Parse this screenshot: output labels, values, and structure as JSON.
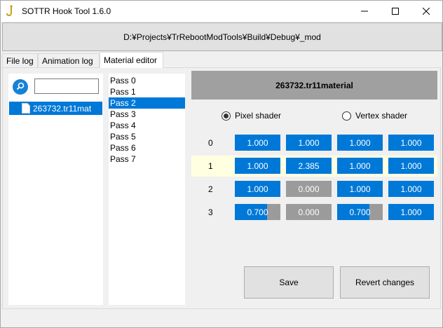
{
  "window": {
    "title": "SOTTR Hook Tool 1.6.0",
    "icon": "hook-icon"
  },
  "path": "D:¥Projects¥TrRebootModTools¥Build¥Debug¥_mod",
  "tabs": [
    {
      "label": "File log"
    },
    {
      "label": "Animation log"
    },
    {
      "label": "Material editor",
      "active": true
    }
  ],
  "file_list": {
    "search_value": "",
    "items": [
      {
        "label": "263732.tr11mat",
        "selected": true
      }
    ]
  },
  "passes": {
    "items": [
      {
        "label": "Pass 0"
      },
      {
        "label": "Pass 1"
      },
      {
        "label": "Pass 2",
        "selected": true
      },
      {
        "label": "Pass 3"
      },
      {
        "label": "Pass 4"
      },
      {
        "label": "Pass 5"
      },
      {
        "label": "Pass 6"
      },
      {
        "label": "Pass 7"
      }
    ]
  },
  "material": {
    "name": "263732.tr11material",
    "shader_options": [
      {
        "label": "Pixel shader",
        "selected": true
      },
      {
        "label": "Vertex shader",
        "selected": false
      }
    ],
    "rows": [
      {
        "label": "0",
        "cells": [
          {
            "text": "1.000",
            "fill": 1.0
          },
          {
            "text": "1.000",
            "fill": 1.0
          },
          {
            "text": "1.000",
            "fill": 1.0
          },
          {
            "text": "1.000",
            "fill": 1.0
          }
        ]
      },
      {
        "label": "1",
        "highlighted": true,
        "cells": [
          {
            "text": "1.000",
            "fill": 1.0
          },
          {
            "text": "2.385",
            "fill": 1.0
          },
          {
            "text": "1.000",
            "fill": 1.0
          },
          {
            "text": "1.000",
            "fill": 1.0
          }
        ]
      },
      {
        "label": "2",
        "cells": [
          {
            "text": "1.000",
            "fill": 1.0
          },
          {
            "text": "0.000",
            "fill": 0.0
          },
          {
            "text": "1.000",
            "fill": 1.0
          },
          {
            "text": "1.000",
            "fill": 1.0
          }
        ]
      },
      {
        "label": "3",
        "cells": [
          {
            "text": "0.700",
            "fill": 0.7
          },
          {
            "text": "0.000",
            "fill": 0.0
          },
          {
            "text": "0.700",
            "fill": 0.7
          },
          {
            "text": "1.000",
            "fill": 1.0
          }
        ]
      }
    ]
  },
  "buttons": {
    "save": "Save",
    "revert": "Revert changes"
  },
  "colors": {
    "accent": "#0078d7",
    "empty_cell": "#9b9b9b",
    "header_bg": "#a0a0a0",
    "highlight_row": "#ffffe1"
  }
}
